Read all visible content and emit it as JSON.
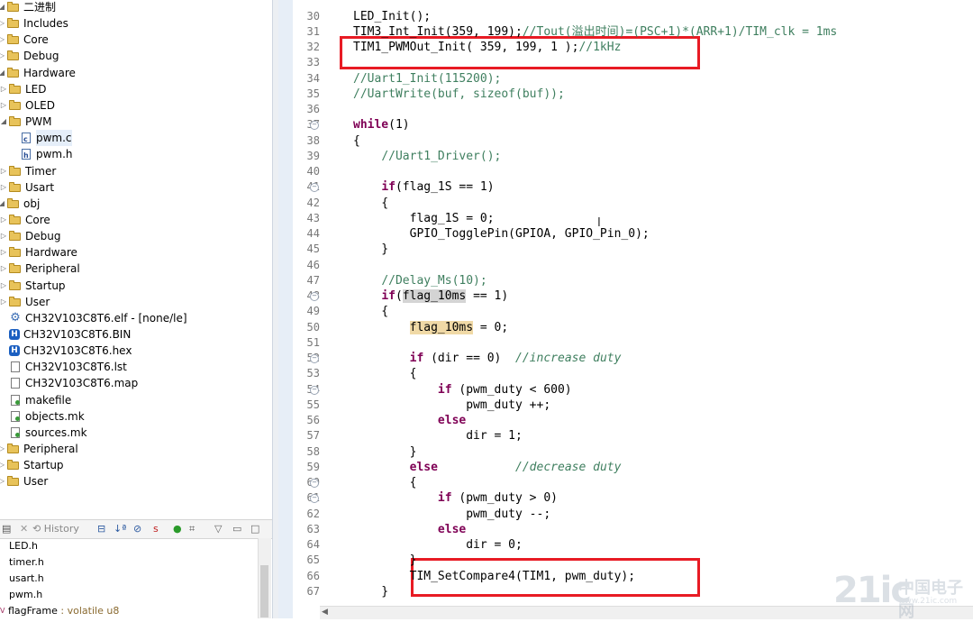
{
  "project_tree": [
    {
      "label": "二进制",
      "indent": 0,
      "icon": "binary-folder-icon",
      "twisty": "down"
    },
    {
      "label": "Includes",
      "indent": 0,
      "icon": "folder-icon",
      "twisty": "right"
    },
    {
      "label": "Core",
      "indent": 0,
      "icon": "folder-icon",
      "twisty": "right"
    },
    {
      "label": "Debug",
      "indent": 0,
      "icon": "folder-icon",
      "twisty": "right"
    },
    {
      "label": "Hardware",
      "indent": 0,
      "icon": "folder-icon",
      "twisty": "down"
    },
    {
      "label": "LED",
      "indent": 1,
      "icon": "folder-icon",
      "twisty": "right"
    },
    {
      "label": "OLED",
      "indent": 1,
      "icon": "folder-icon",
      "twisty": "right"
    },
    {
      "label": "PWM",
      "indent": 1,
      "icon": "folder-icon",
      "twisty": "down"
    },
    {
      "label": "pwm.c",
      "indent": 2,
      "icon": "c-file-icon",
      "twisty": "",
      "selected": true
    },
    {
      "label": "pwm.h",
      "indent": 2,
      "icon": "h-file-icon",
      "twisty": ""
    },
    {
      "label": "Timer",
      "indent": 1,
      "icon": "folder-icon",
      "twisty": "right"
    },
    {
      "label": "Usart",
      "indent": 1,
      "icon": "folder-icon",
      "twisty": "right"
    },
    {
      "label": "obj",
      "indent": 0,
      "icon": "folder-icon",
      "twisty": "down"
    },
    {
      "label": "Core",
      "indent": 1,
      "icon": "folder-icon",
      "twisty": "right"
    },
    {
      "label": "Debug",
      "indent": 1,
      "icon": "folder-icon",
      "twisty": "right"
    },
    {
      "label": "Hardware",
      "indent": 1,
      "icon": "folder-icon",
      "twisty": "right"
    },
    {
      "label": "Peripheral",
      "indent": 1,
      "icon": "folder-icon",
      "twisty": "right"
    },
    {
      "label": "Startup",
      "indent": 1,
      "icon": "folder-icon",
      "twisty": "right"
    },
    {
      "label": "User",
      "indent": 1,
      "icon": "folder-icon",
      "twisty": "right"
    },
    {
      "label": "CH32V103C8T6.elf - [none/le]",
      "indent": 1,
      "icon": "gear-icon",
      "twisty": ""
    },
    {
      "label": "CH32V103C8T6.BIN",
      "indent": 1,
      "icon": "hex-file-icon",
      "twisty": ""
    },
    {
      "label": "CH32V103C8T6.hex",
      "indent": 1,
      "icon": "hex-file-icon",
      "twisty": ""
    },
    {
      "label": "CH32V103C8T6.lst",
      "indent": 1,
      "icon": "file-icon",
      "twisty": ""
    },
    {
      "label": "CH32V103C8T6.map",
      "indent": 1,
      "icon": "file-icon",
      "twisty": ""
    },
    {
      "label": "makefile",
      "indent": 1,
      "icon": "makefile-icon",
      "twisty": ""
    },
    {
      "label": "objects.mk",
      "indent": 1,
      "icon": "makefile-icon",
      "twisty": ""
    },
    {
      "label": "sources.mk",
      "indent": 1,
      "icon": "makefile-icon",
      "twisty": ""
    },
    {
      "label": "Peripheral",
      "indent": 0,
      "icon": "folder-icon",
      "twisty": "right"
    },
    {
      "label": "Startup",
      "indent": 0,
      "icon": "folder-icon",
      "twisty": "right"
    },
    {
      "label": "User",
      "indent": 0,
      "icon": "folder-icon",
      "twisty": "right"
    }
  ],
  "outline_tab": {
    "history_label": "History"
  },
  "outline_items": [
    {
      "label": "LED.h"
    },
    {
      "label": "timer.h"
    },
    {
      "label": "usart.h"
    },
    {
      "label": "pwm.h"
    },
    {
      "label": "flagFrame",
      "type": " : volatile u8"
    }
  ],
  "editor": {
    "lines": [
      {
        "n": "30",
        "html": "LED_Init();"
      },
      {
        "n": "31",
        "html": "TIM3_Int_Init(359, 199);<span class=\"cm\">//Tout(溢出时间)=(PSC+1)*(ARR+1)/TIM_clk = 1ms</span>"
      },
      {
        "n": "32",
        "html": "TIM1_PWMOut_Init( 359, 199, 1 );<span class=\"cm\">//1kHz</span>"
      },
      {
        "n": "33",
        "html": ""
      },
      {
        "n": "34",
        "html": "<span class=\"cm\">//Uart1_Init(115200);</span>"
      },
      {
        "n": "35",
        "html": "<span class=\"cm\">//UartWrite(buf, sizeof(buf));</span>"
      },
      {
        "n": "36",
        "html": ""
      },
      {
        "n": "37",
        "html": "<span class=\"kw\">while</span>(1)",
        "fold": true
      },
      {
        "n": "38",
        "html": "{"
      },
      {
        "n": "39",
        "html": "    <span class=\"cm\">//Uart1_Driver();</span>"
      },
      {
        "n": "40",
        "html": ""
      },
      {
        "n": "41",
        "html": "    <span class=\"kw\">if</span>(flag_1S == 1)",
        "fold": true
      },
      {
        "n": "42",
        "html": "    {"
      },
      {
        "n": "43",
        "html": "        flag_1S = 0;"
      },
      {
        "n": "44",
        "html": "        GPIO_TogglePin(GPIOA, GPIO_Pin_0);"
      },
      {
        "n": "45",
        "html": "    }"
      },
      {
        "n": "46",
        "html": ""
      },
      {
        "n": "47",
        "html": "    <span class=\"cm\">//Delay_Ms(10);</span>"
      },
      {
        "n": "48",
        "html": "    <span class=\"kw\">if</span>(<span class=\"hl2\">flag_10ms</span> == 1)",
        "fold": true
      },
      {
        "n": "49",
        "html": "    {"
      },
      {
        "n": "50",
        "html": "        <span class=\"hl\">flag_10ms</span> = 0;"
      },
      {
        "n": "51",
        "html": ""
      },
      {
        "n": "52",
        "html": "        <span class=\"kw\">if</span> (dir == 0)  <span class=\"cm\"><i>//increase duty</i></span>",
        "fold": true
      },
      {
        "n": "53",
        "html": "        {"
      },
      {
        "n": "54",
        "html": "            <span class=\"kw\">if</span> (pwm_duty &lt; 600)",
        "fold": true
      },
      {
        "n": "55",
        "html": "                pwm_duty ++;"
      },
      {
        "n": "56",
        "html": "            <span class=\"kw\">else</span>"
      },
      {
        "n": "57",
        "html": "                dir = 1;"
      },
      {
        "n": "58",
        "html": "        }"
      },
      {
        "n": "59",
        "html": "        <span class=\"kw\">else</span>           <span class=\"cm\"><i>//decrease duty</i></span>"
      },
      {
        "n": "60",
        "html": "        {",
        "fold": true
      },
      {
        "n": "61",
        "html": "            <span class=\"kw\">if</span> (pwm_duty &gt; 0)",
        "fold": true
      },
      {
        "n": "62",
        "html": "                pwm_duty --;"
      },
      {
        "n": "63",
        "html": "            <span class=\"kw\">else</span>"
      },
      {
        "n": "64",
        "html": "                dir = 0;"
      },
      {
        "n": "65",
        "html": "        }"
      },
      {
        "n": "66",
        "html": "        TIM_SetCompare4(TIM1, pwm_duty);"
      },
      {
        "n": "67",
        "html": "    }"
      }
    ]
  },
  "watermark": {
    "brand": "21ic",
    "cn": "中国电子网",
    "url": "www.21ic.com"
  },
  "colors": {
    "keyword": "#7f0055",
    "comment": "#3f7f5f",
    "highlight_box": "#e81b24"
  }
}
